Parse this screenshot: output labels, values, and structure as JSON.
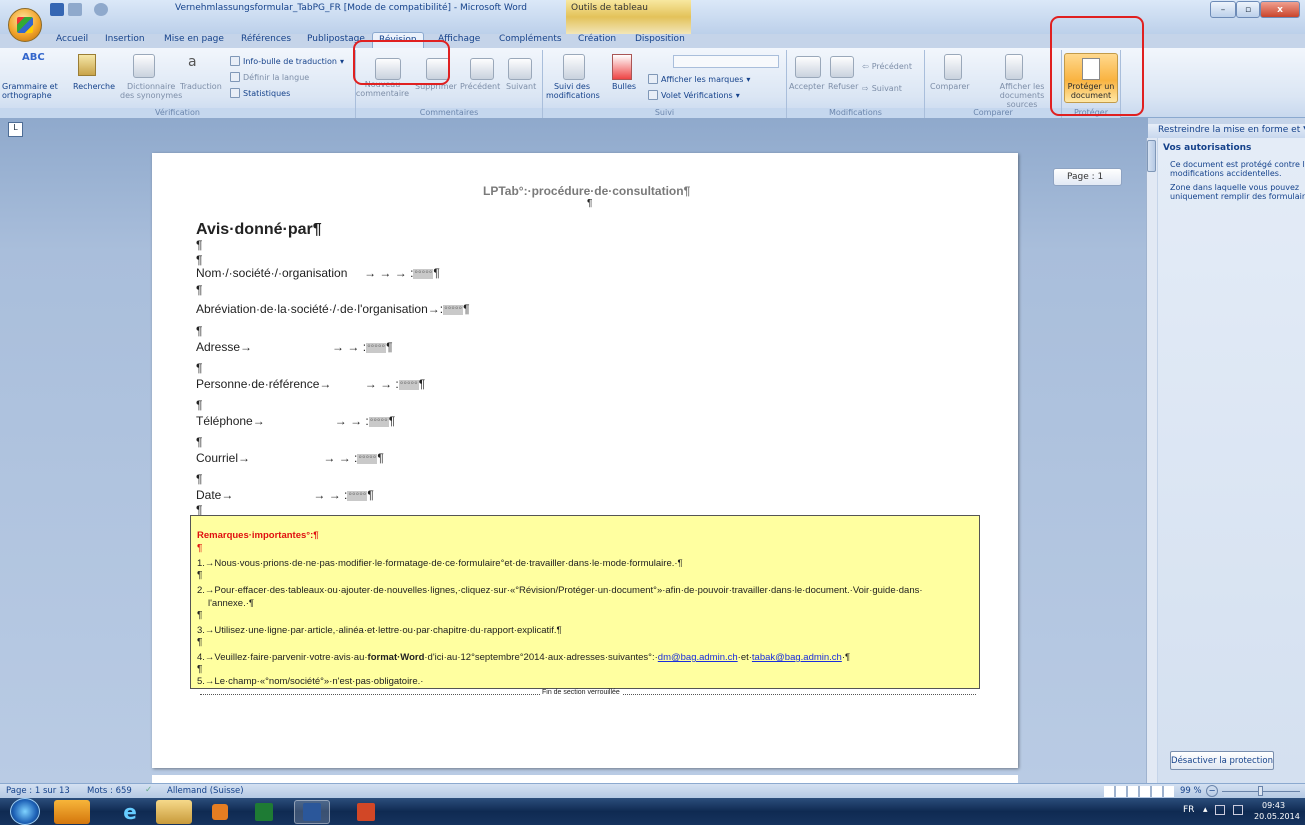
{
  "window": {
    "title": "Vernehmlassungsformular_TabPG_FR [Mode de compatibilité] - Microsoft Word",
    "context_tab": "Outils de tableau",
    "min_label": "–",
    "max_label": "▫",
    "close_label": "x"
  },
  "tabs": [
    "Accueil",
    "Insertion",
    "Mise en page",
    "Références",
    "Publipostage",
    "Révision",
    "Affichage",
    "Compléments",
    "Création",
    "Disposition"
  ],
  "ribbon": {
    "verification": {
      "label": "Vérification",
      "grammar": "Grammaire et\northographe",
      "search": "Recherche",
      "dictionary": "Dictionnaire\ndes synonymes",
      "translate": "Traduction",
      "tooltip": "Info-bulle de traduction",
      "language": "Définir la langue",
      "stats": "Statistiques"
    },
    "comments": {
      "label": "Commentaires",
      "new": "Nouveau\ncommentaire",
      "delete": "Supprimer",
      "prev": "Précédent",
      "next": "Suivant"
    },
    "tracking": {
      "label": "Suivi",
      "track": "Suivi des\nmodifications",
      "bubbles": "Bulles",
      "show_markup": "Afficher les marques",
      "review_pane": "Volet Vérifications"
    },
    "changes": {
      "label": "Modifications",
      "accept": "Accepter",
      "reject": "Refuser",
      "previous": "Précédent",
      "next": "Suivant"
    },
    "compare": {
      "label": "Comparer",
      "compare": "Comparer",
      "show_source": "Afficher les\ndocuments sources"
    },
    "protect": {
      "label": "Protéger",
      "protect_doc": "Protéger un\ndocument"
    }
  },
  "document": {
    "page_indicator": "Page : 1",
    "header": "LPTab°:·procédure·de·consultation¶",
    "heading": "Avis·donné·par¶",
    "pilcrow": "¶",
    "field_value": "°°°°°",
    "fields": [
      {
        "label": "Nom·/·société·/·organisation",
        "tabs": "→      → → :"
      },
      {
        "label": "Abréviation·de·la·société·/·de·l'organisation→",
        "tabs": ":"
      },
      {
        "label": "Adresse",
        "tabs": "→                        → → :"
      },
      {
        "label": "Personne·de·référence",
        "tabs": "→          → → :"
      },
      {
        "label": "Téléphone",
        "tabs": "→                     → → :"
      },
      {
        "label": "Courriel",
        "tabs": "→                      → → :"
      },
      {
        "label": "Date",
        "tabs": "→                        → → :"
      }
    ],
    "remarks": {
      "title": "Remarques·importantes°:¶",
      "items": [
        "1.→Nous·vous·prions·de·ne·pas·modifier·le·formatage·de·ce·formulaire°et·de·travailler·dans·le·mode·formulaire.·¶",
        "2.→Pour·effacer·des·tableaux·ou·ajouter·de·nouvelles·lignes,·cliquez·sur·«°Révision/Protéger·un·document°»·afin·de·pouvoir·travailler·dans·le·document.·Voir·guide·dans·",
        "l'annexe.·¶",
        "3.→Utilisez·une·ligne·par·article,·alinéa·et·lettre·ou·par·chapitre·du·rapport·explicatif.¶",
        "4.→Veuillez·faire·parvenir·votre·avis·au·",
        "format·Word",
        "·d'ici·au·12°septembre°2014·aux·adresses·suivantes°:·",
        "dm@bag.admin.ch",
        "·et·",
        "tabak@bag.admin.ch",
        "·¶",
        "5.→Le·champ·«°nom/société°»·n'est·pas·obligatoire.·"
      ]
    },
    "section_end": "Fin de section verrouillée"
  },
  "pane": {
    "header": "Restreindre la mise en forme et ▼",
    "title": "Vos autorisations",
    "lines": [
      "Ce document est protégé contre les",
      "modifications accidentelles.",
      "Zone dans laquelle vous pouvez",
      "uniquement remplir des formulaires."
    ],
    "unprotect": "Désactiver la protection"
  },
  "status": {
    "page": "Page : 1 sur 13",
    "words": "Mots : 659",
    "language": "Allemand (Suisse)",
    "zoom": "99 %"
  },
  "taskbar": {
    "lang": "FR",
    "time": "09:43",
    "date": "20.05.2014"
  },
  "colors": {
    "accent_red": "#e02020",
    "remark_bg": "#ffffa0",
    "remark_title": "#e01010"
  }
}
